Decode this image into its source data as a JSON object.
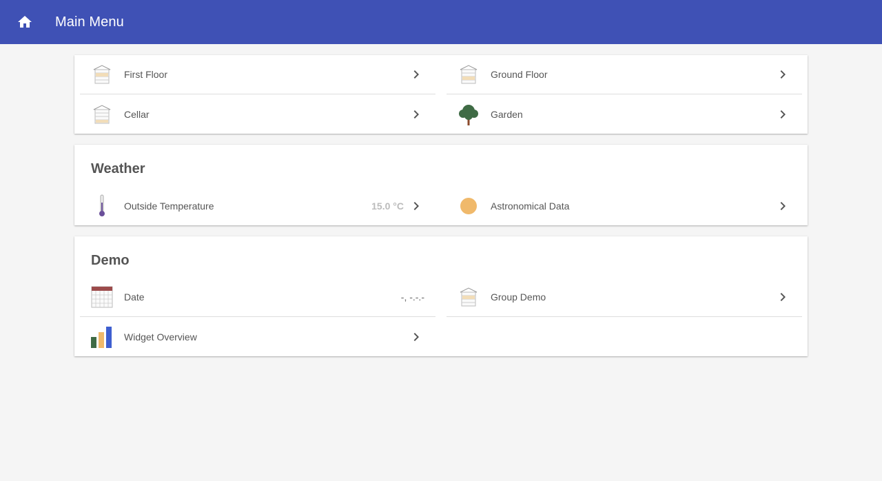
{
  "header": {
    "title": "Main Menu",
    "icon": "home-icon",
    "bg_color": "#3f51b5"
  },
  "locations": [
    {
      "label": "First Floor",
      "icon": "house-icon"
    },
    {
      "label": "Ground Floor",
      "icon": "house-icon"
    },
    {
      "label": "Cellar",
      "icon": "house-icon"
    },
    {
      "label": "Garden",
      "icon": "tree-icon"
    }
  ],
  "weather": {
    "title": "Weather",
    "items": [
      {
        "label": "Outside Temperature",
        "value": "15.0 °C",
        "icon": "thermometer-icon"
      },
      {
        "label": "Astronomical Data",
        "icon": "sun-icon"
      }
    ]
  },
  "demo": {
    "title": "Demo",
    "items": [
      {
        "label": "Date",
        "value": "-, -.-.-",
        "icon": "calendar-icon"
      },
      {
        "label": "Group Demo",
        "icon": "house-icon"
      },
      {
        "label": "Widget Overview",
        "icon": "bar-chart-icon"
      }
    ]
  }
}
